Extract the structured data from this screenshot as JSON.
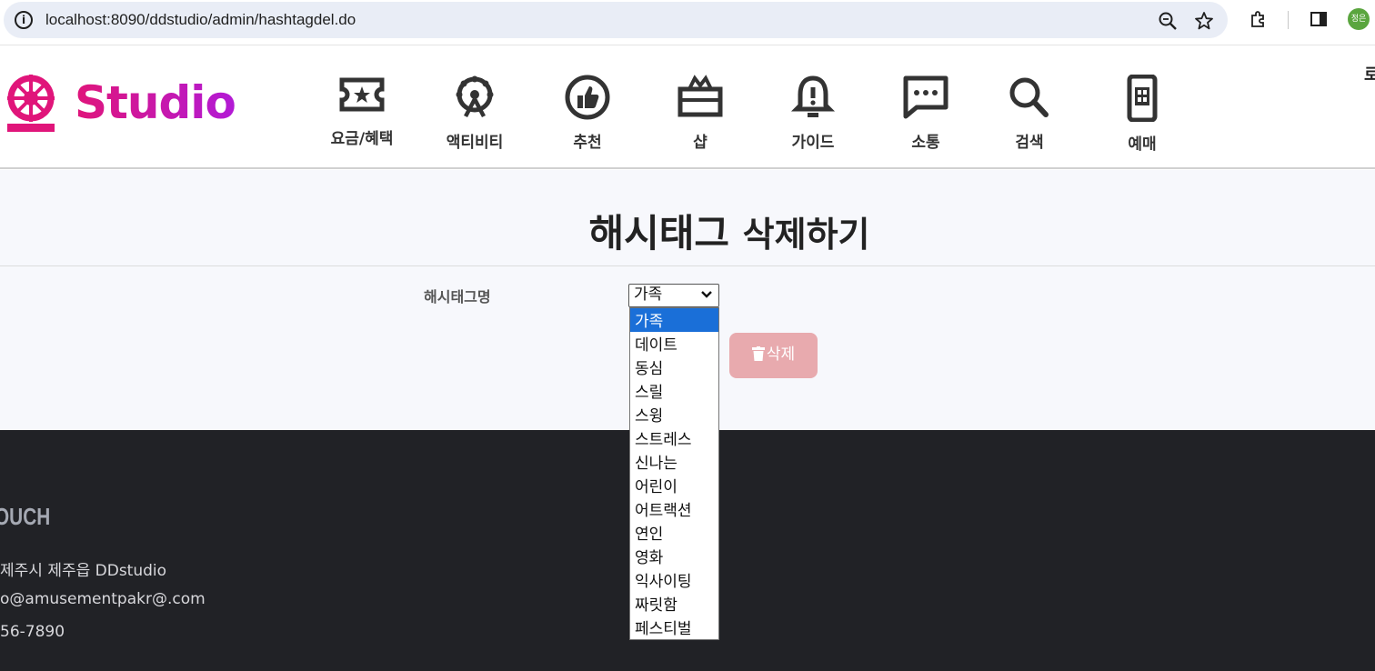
{
  "browser": {
    "url": "localhost:8090/ddstudio/admin/hashtagdel.do",
    "profile_initials": "정은"
  },
  "header": {
    "logo_text": "Studio",
    "nav": [
      {
        "label": "요금/혜택",
        "icon": "ticket-icon"
      },
      {
        "label": "액티비티",
        "icon": "ferris-wheel-icon"
      },
      {
        "label": "추천",
        "icon": "thumbs-up-icon"
      },
      {
        "label": "샵",
        "icon": "gift-box-icon"
      },
      {
        "label": "가이드",
        "icon": "bell-alert-icon"
      },
      {
        "label": "소통",
        "icon": "chat-bubble-icon"
      },
      {
        "label": "검색",
        "icon": "search-icon"
      },
      {
        "label": "예매",
        "icon": "mobile-phone-icon"
      }
    ]
  },
  "main": {
    "title": "해시태그",
    "title_sub": "삭제하기",
    "field_label": "해시태그명",
    "select_value": "가족",
    "delete_label": "삭제",
    "options": [
      "가족",
      "데이트",
      "동심",
      "스릴",
      "스윙",
      "스트레스",
      "신나는",
      "어린이",
      "어트랙션",
      "연인",
      "영화",
      "익사이팅",
      "짜릿함",
      "페스티벌"
    ],
    "selected_option": "가족"
  },
  "footer": {
    "heading": "OUCH",
    "address": "제주시 제주읍 DDstudio",
    "email": "o@amusementpakr@.com",
    "phone": "56-7890"
  },
  "colors": {
    "brand_pink": "#e0157a",
    "brand_purple": "#b21ad6",
    "delete_button": "#e8aaae",
    "footer_bg": "#212226",
    "selected_option_bg": "#1a6fd8"
  }
}
